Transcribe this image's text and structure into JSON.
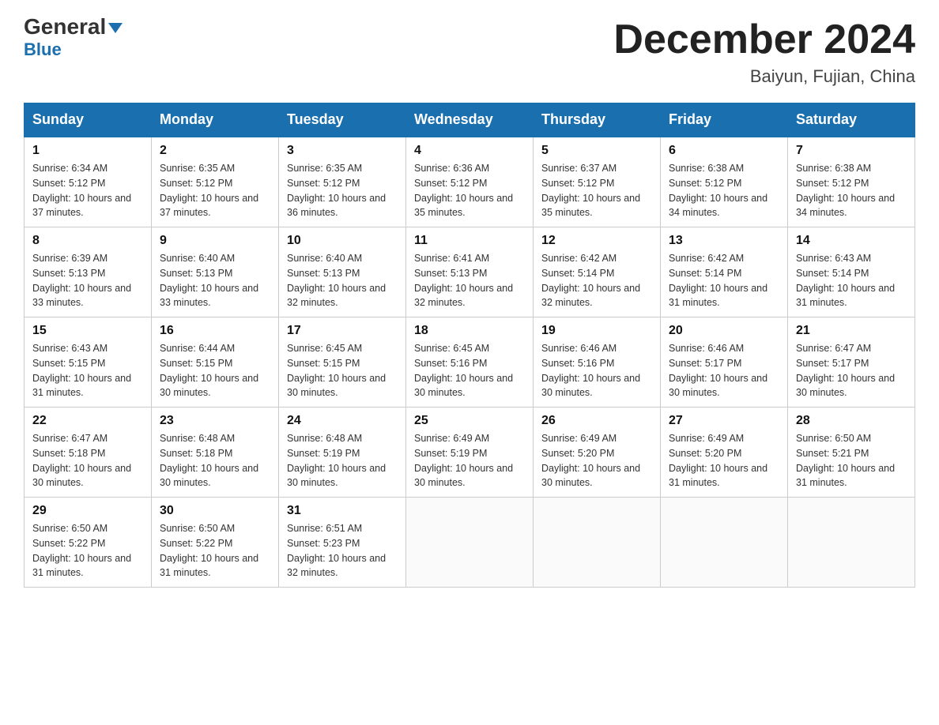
{
  "logo": {
    "line1": "General",
    "triangle": "▼",
    "line2": "Blue"
  },
  "title": {
    "month_year": "December 2024",
    "location": "Baiyun, Fujian, China"
  },
  "headers": [
    "Sunday",
    "Monday",
    "Tuesday",
    "Wednesday",
    "Thursday",
    "Friday",
    "Saturday"
  ],
  "weeks": [
    [
      {
        "day": "1",
        "sunrise": "Sunrise: 6:34 AM",
        "sunset": "Sunset: 5:12 PM",
        "daylight": "Daylight: 10 hours and 37 minutes."
      },
      {
        "day": "2",
        "sunrise": "Sunrise: 6:35 AM",
        "sunset": "Sunset: 5:12 PM",
        "daylight": "Daylight: 10 hours and 37 minutes."
      },
      {
        "day": "3",
        "sunrise": "Sunrise: 6:35 AM",
        "sunset": "Sunset: 5:12 PM",
        "daylight": "Daylight: 10 hours and 36 minutes."
      },
      {
        "day": "4",
        "sunrise": "Sunrise: 6:36 AM",
        "sunset": "Sunset: 5:12 PM",
        "daylight": "Daylight: 10 hours and 35 minutes."
      },
      {
        "day": "5",
        "sunrise": "Sunrise: 6:37 AM",
        "sunset": "Sunset: 5:12 PM",
        "daylight": "Daylight: 10 hours and 35 minutes."
      },
      {
        "day": "6",
        "sunrise": "Sunrise: 6:38 AM",
        "sunset": "Sunset: 5:12 PM",
        "daylight": "Daylight: 10 hours and 34 minutes."
      },
      {
        "day": "7",
        "sunrise": "Sunrise: 6:38 AM",
        "sunset": "Sunset: 5:12 PM",
        "daylight": "Daylight: 10 hours and 34 minutes."
      }
    ],
    [
      {
        "day": "8",
        "sunrise": "Sunrise: 6:39 AM",
        "sunset": "Sunset: 5:13 PM",
        "daylight": "Daylight: 10 hours and 33 minutes."
      },
      {
        "day": "9",
        "sunrise": "Sunrise: 6:40 AM",
        "sunset": "Sunset: 5:13 PM",
        "daylight": "Daylight: 10 hours and 33 minutes."
      },
      {
        "day": "10",
        "sunrise": "Sunrise: 6:40 AM",
        "sunset": "Sunset: 5:13 PM",
        "daylight": "Daylight: 10 hours and 32 minutes."
      },
      {
        "day": "11",
        "sunrise": "Sunrise: 6:41 AM",
        "sunset": "Sunset: 5:13 PM",
        "daylight": "Daylight: 10 hours and 32 minutes."
      },
      {
        "day": "12",
        "sunrise": "Sunrise: 6:42 AM",
        "sunset": "Sunset: 5:14 PM",
        "daylight": "Daylight: 10 hours and 32 minutes."
      },
      {
        "day": "13",
        "sunrise": "Sunrise: 6:42 AM",
        "sunset": "Sunset: 5:14 PM",
        "daylight": "Daylight: 10 hours and 31 minutes."
      },
      {
        "day": "14",
        "sunrise": "Sunrise: 6:43 AM",
        "sunset": "Sunset: 5:14 PM",
        "daylight": "Daylight: 10 hours and 31 minutes."
      }
    ],
    [
      {
        "day": "15",
        "sunrise": "Sunrise: 6:43 AM",
        "sunset": "Sunset: 5:15 PM",
        "daylight": "Daylight: 10 hours and 31 minutes."
      },
      {
        "day": "16",
        "sunrise": "Sunrise: 6:44 AM",
        "sunset": "Sunset: 5:15 PM",
        "daylight": "Daylight: 10 hours and 30 minutes."
      },
      {
        "day": "17",
        "sunrise": "Sunrise: 6:45 AM",
        "sunset": "Sunset: 5:15 PM",
        "daylight": "Daylight: 10 hours and 30 minutes."
      },
      {
        "day": "18",
        "sunrise": "Sunrise: 6:45 AM",
        "sunset": "Sunset: 5:16 PM",
        "daylight": "Daylight: 10 hours and 30 minutes."
      },
      {
        "day": "19",
        "sunrise": "Sunrise: 6:46 AM",
        "sunset": "Sunset: 5:16 PM",
        "daylight": "Daylight: 10 hours and 30 minutes."
      },
      {
        "day": "20",
        "sunrise": "Sunrise: 6:46 AM",
        "sunset": "Sunset: 5:17 PM",
        "daylight": "Daylight: 10 hours and 30 minutes."
      },
      {
        "day": "21",
        "sunrise": "Sunrise: 6:47 AM",
        "sunset": "Sunset: 5:17 PM",
        "daylight": "Daylight: 10 hours and 30 minutes."
      }
    ],
    [
      {
        "day": "22",
        "sunrise": "Sunrise: 6:47 AM",
        "sunset": "Sunset: 5:18 PM",
        "daylight": "Daylight: 10 hours and 30 minutes."
      },
      {
        "day": "23",
        "sunrise": "Sunrise: 6:48 AM",
        "sunset": "Sunset: 5:18 PM",
        "daylight": "Daylight: 10 hours and 30 minutes."
      },
      {
        "day": "24",
        "sunrise": "Sunrise: 6:48 AM",
        "sunset": "Sunset: 5:19 PM",
        "daylight": "Daylight: 10 hours and 30 minutes."
      },
      {
        "day": "25",
        "sunrise": "Sunrise: 6:49 AM",
        "sunset": "Sunset: 5:19 PM",
        "daylight": "Daylight: 10 hours and 30 minutes."
      },
      {
        "day": "26",
        "sunrise": "Sunrise: 6:49 AM",
        "sunset": "Sunset: 5:20 PM",
        "daylight": "Daylight: 10 hours and 30 minutes."
      },
      {
        "day": "27",
        "sunrise": "Sunrise: 6:49 AM",
        "sunset": "Sunset: 5:20 PM",
        "daylight": "Daylight: 10 hours and 31 minutes."
      },
      {
        "day": "28",
        "sunrise": "Sunrise: 6:50 AM",
        "sunset": "Sunset: 5:21 PM",
        "daylight": "Daylight: 10 hours and 31 minutes."
      }
    ],
    [
      {
        "day": "29",
        "sunrise": "Sunrise: 6:50 AM",
        "sunset": "Sunset: 5:22 PM",
        "daylight": "Daylight: 10 hours and 31 minutes."
      },
      {
        "day": "30",
        "sunrise": "Sunrise: 6:50 AM",
        "sunset": "Sunset: 5:22 PM",
        "daylight": "Daylight: 10 hours and 31 minutes."
      },
      {
        "day": "31",
        "sunrise": "Sunrise: 6:51 AM",
        "sunset": "Sunset: 5:23 PM",
        "daylight": "Daylight: 10 hours and 32 minutes."
      },
      null,
      null,
      null,
      null
    ]
  ]
}
